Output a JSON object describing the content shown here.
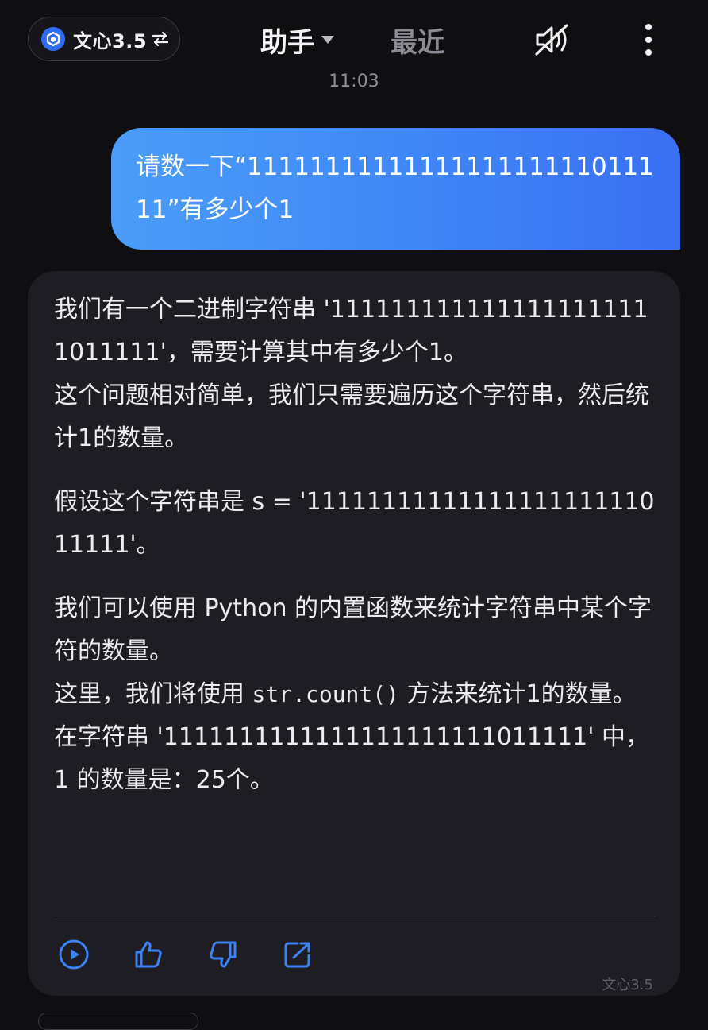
{
  "header": {
    "model_name": "文心3.5",
    "tab_assistant": "助手",
    "tab_recent": "最近"
  },
  "conversation": {
    "timestamp": "11:03",
    "user_message": "请数一下“1111111111111111111111011111”有多少个1",
    "bot_reply": {
      "p1": "我们有一个二进制字符串 '1111111111111111111111011111'，需要计算其中有多少个1。",
      "p2": "这个问题相对简单，我们只需要遍历这个字符串，然后统计1的数量。",
      "p3": "假设这个字符串是 s = '1111111111111111111111011111'。",
      "p4": "我们可以使用 Python 的内置函数来统计字符串中某个字符的数量。",
      "p5_before": "这里，我们将使用 ",
      "p5_code": "str.count()",
      "p5_after": " 方法来统计1的数量。",
      "p6": "在字符串 '1111111111111111111111011111' 中，1 的数量是：25个。"
    },
    "bot_model_tag": "文心3.5"
  },
  "colors": {
    "background": "#0f0f11",
    "card": "#1d1d23",
    "accent": "#3a86f6",
    "icon_blue": "#3d83f5"
  },
  "icons": {
    "model_logo": "ernie-cube-icon",
    "swap": "swap-arrows-icon",
    "caret": "caret-down-icon",
    "mute": "mute-speaker-icon",
    "more": "more-vertical-icon",
    "play": "play-icon",
    "like": "thumbs-up-icon",
    "dislike": "thumbs-down-icon",
    "share": "share-icon"
  }
}
